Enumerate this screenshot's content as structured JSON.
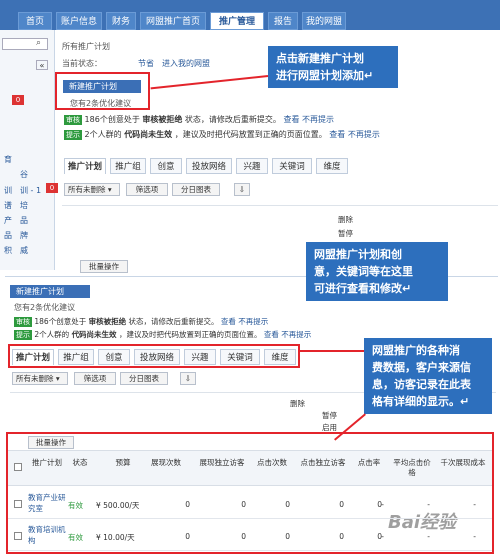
{
  "topnav": {
    "tabs": [
      "首页",
      "账户信息",
      "财务",
      "网盟推广首页",
      "推广管理",
      "报告",
      "我的网盟"
    ],
    "active": 4
  },
  "sidebar": {
    "labels": [
      "育",
      "谷",
      "训",
      "训 - 1",
      "谱",
      "培",
      "产",
      "品",
      "品",
      "牌",
      "积",
      "威"
    ],
    "badges": [
      "0",
      "0"
    ]
  },
  "top_panel": {
    "breadcrumb": "所有推广计划",
    "status_line": "当前状态：",
    "status_links": [
      "节省",
      "进入我的网盟"
    ],
    "new_plan_button": "新建推广计划",
    "optimize_tip": "您有2条优化建议",
    "notices": [
      {
        "badge": "审核",
        "text": "186个创意处于",
        "bold": "审核被拒绝",
        "tail": "状态，请修改后重新提交。",
        "view": "查看",
        "dismiss": "不再提示"
      },
      {
        "badge": "提示",
        "text": "2个人群的",
        "bold": "代码尚未生效",
        "tail": "，建议及时把代码放置到正确的页面位置。",
        "view": "查看",
        "dismiss": "不再提示"
      }
    ],
    "subtabs": [
      "推广计划",
      "推广组",
      "创意",
      "投放网络",
      "兴趣",
      "关键词",
      "维度"
    ],
    "filter_select": "所有未删除",
    "filter_buttons": [
      "筛选项",
      "分日图表"
    ],
    "grid_labels": [
      "删除",
      "暂停"
    ],
    "batch_button": "批量操作"
  },
  "bottom_panel": {
    "new_plan_button": "新建推广计划",
    "optimize_tip": "您有2条优化建议",
    "notices": [
      {
        "badge": "审核",
        "text": "186个创意处于",
        "bold": "审核被拒绝",
        "tail": "状态，请修改后重新提交。",
        "view": "查看",
        "dismiss": "不再提示"
      },
      {
        "badge": "提示",
        "text": "2个人群的",
        "bold": "代码尚未生效",
        "tail": "，建议及时把代码放置到正确的页面位置。",
        "view": "查看",
        "dismiss": "不再提示"
      }
    ],
    "subtabs": [
      "推广计划",
      "推广组",
      "创意",
      "投放网络",
      "兴趣",
      "关键词",
      "维度"
    ],
    "filter_select": "所有未删除",
    "filter_buttons": [
      "筛选项",
      "分日图表"
    ],
    "grid_labels": [
      "删除",
      "暂停",
      "启用"
    ],
    "batch_button": "批量操作",
    "table": {
      "headers": [
        "推广计划",
        "状态",
        "预算",
        "展现次数",
        "展现独立访客",
        "点击次数",
        "点击独立访客",
        "点击率",
        "平均点击价格",
        "千次展现成本"
      ],
      "rows": [
        {
          "name": "教育产业研究室",
          "status": "有效",
          "budget": "¥ 500.00/天",
          "values": [
            "0",
            "0",
            "0",
            "0",
            "0",
            "-",
            "-",
            "-"
          ]
        },
        {
          "name": "教育培训机构",
          "status": "有效",
          "budget": "¥ 10.00/天",
          "values": [
            "0",
            "0",
            "0",
            "0",
            "0",
            "-",
            "-",
            "-"
          ]
        }
      ]
    }
  },
  "callouts": [
    "点击新建推广计划\n进行网盟计划添加↵",
    "网盟推广计划和创\n意，关键词等在这里\n可进行查看和修改↵",
    "网盟推广的各种消\n费数据，客户来源信\n息，访客记录在此表\n格有详细的显示。↵"
  ],
  "watermark": "Bai经验"
}
